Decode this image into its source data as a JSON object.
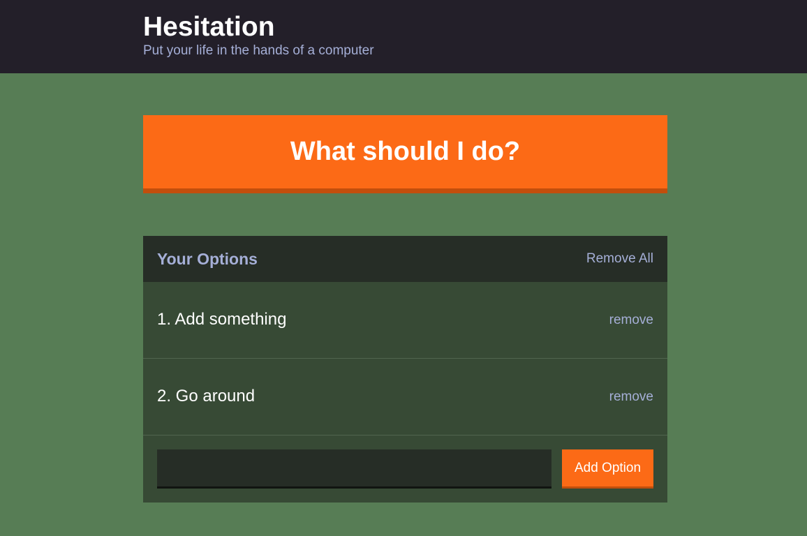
{
  "header": {
    "title": "Hesitation",
    "subtitle": "Put your life in the hands of a computer"
  },
  "action": {
    "label": "What should I do?"
  },
  "options_panel": {
    "title": "Your Options",
    "remove_all_label": "Remove All",
    "items": [
      {
        "text": "1. Add something",
        "remove_label": "remove"
      },
      {
        "text": "2. Go around",
        "remove_label": "remove"
      }
    ],
    "add_form": {
      "input_value": "",
      "button_label": "Add Option"
    }
  },
  "colors": {
    "background": "#577d55",
    "header_bg": "#231f29",
    "accent": "#fc6a16",
    "panel_bg": "#374a35",
    "panel_header_bg": "#262d26",
    "muted_text": "#a5afd7"
  }
}
